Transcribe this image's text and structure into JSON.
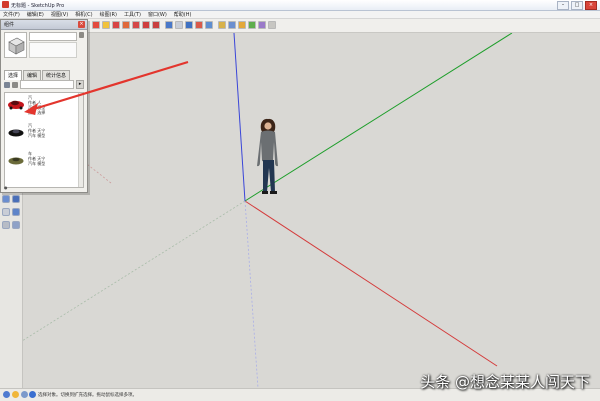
{
  "window": {
    "title": "无标题 - SketchUp Pro",
    "minimize_label": "–",
    "maximize_label": "□",
    "close_label": "×"
  },
  "menubar": {
    "items": [
      "文件(F)",
      "编辑(E)",
      "视图(V)",
      "相机(C)",
      "绘图(R)",
      "工具(T)",
      "窗口(W)",
      "帮助(H)"
    ]
  },
  "components_panel": {
    "title": "组件",
    "close_label": "×",
    "tabs": [
      "选择",
      "编辑",
      "统计信息"
    ],
    "items": [
      {
        "name": "汽",
        "line2": "作者 人",
        "line3": "汽车 模型",
        "line4": "点击 选择"
      },
      {
        "name": "汽",
        "line2": "作者 天宁",
        "line3": "汽车 模型"
      },
      {
        "name": "车",
        "line2": "作者 天宁",
        "line3": "汽车 模型"
      }
    ],
    "arrow_label": "▸"
  },
  "statusbar": {
    "text": "选择对象。切换到扩充选择。拖动鼠标选择多项。"
  },
  "watermark": {
    "text": "头条 @想念某某人闯天下"
  },
  "colors": {
    "background": "#d9d8d4",
    "axis_blue": "#3a46d8",
    "axis_green": "#1d9e2a",
    "axis_red": "#d43b3b",
    "annotation_arrow": "#e3352d"
  }
}
